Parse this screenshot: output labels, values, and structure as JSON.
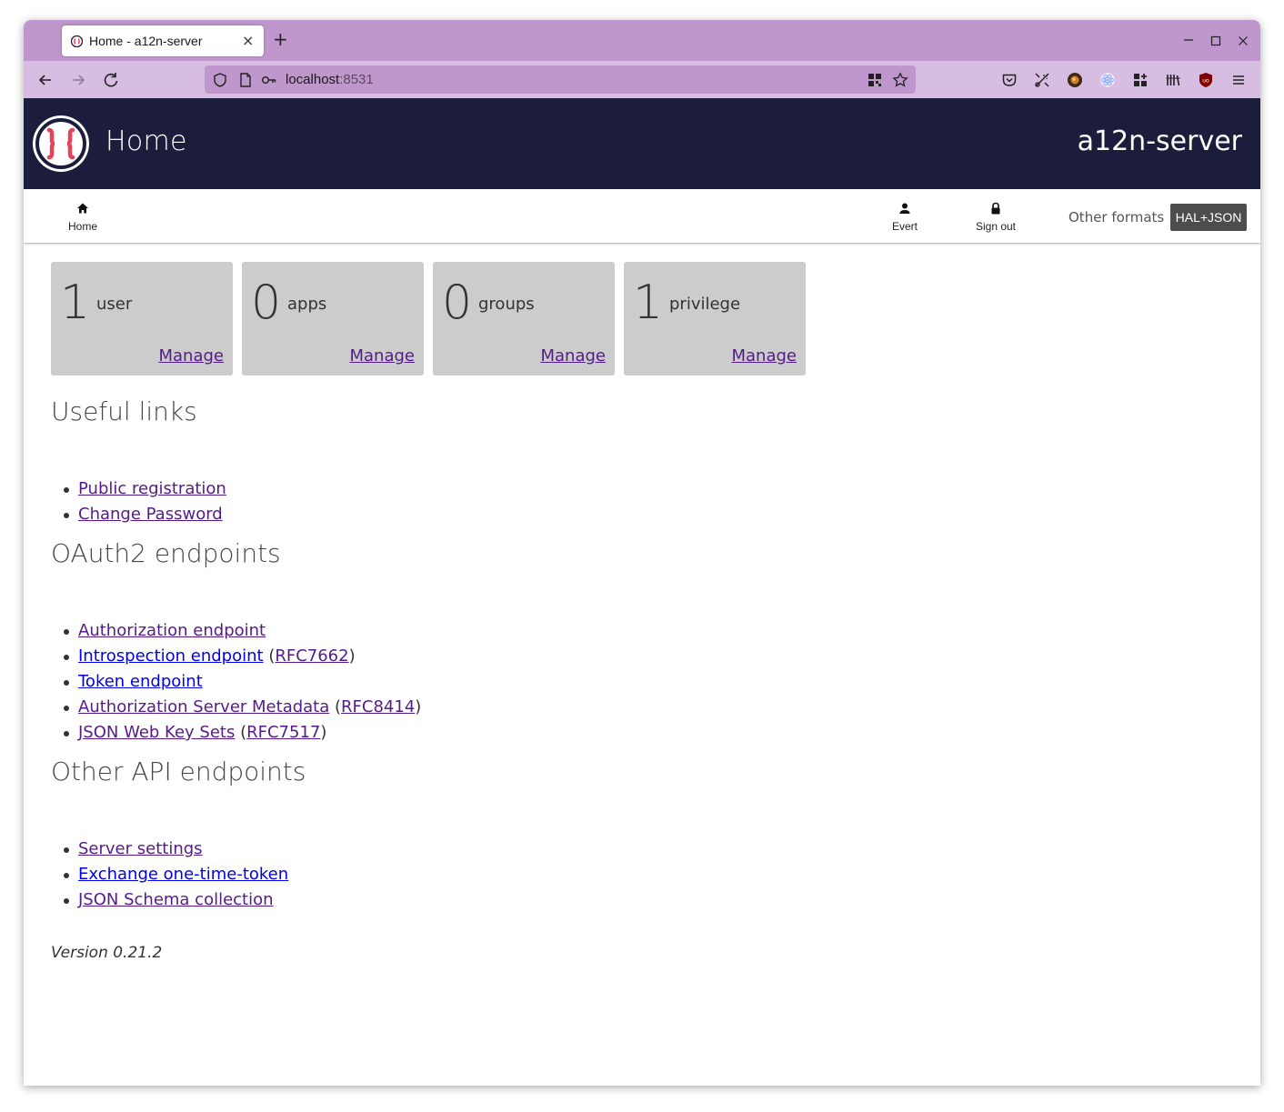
{
  "browser": {
    "tab_title": "Home - a12n-server",
    "new_tab": "+",
    "tab_close": "×",
    "url_host": "localhost",
    "url_port": ":8531"
  },
  "header": {
    "title": "Home",
    "app_name": "a12n-server"
  },
  "subnav": {
    "home_label": "Home",
    "user_label": "Evert",
    "signout_label": "Sign out",
    "other_formats": "Other formats",
    "format_button": "HAL+JSON"
  },
  "cards": [
    {
      "count": "1",
      "unit": "user",
      "action": "Manage"
    },
    {
      "count": "0",
      "unit": "apps",
      "action": "Manage"
    },
    {
      "count": "0",
      "unit": "groups",
      "action": "Manage"
    },
    {
      "count": "1",
      "unit": "privilege",
      "action": "Manage"
    }
  ],
  "useful_links": {
    "heading": "Useful links",
    "items": [
      "Public registration",
      "Change Password"
    ]
  },
  "oauth2": {
    "heading": "OAuth2 endpoints",
    "authorization": "Authorization endpoint",
    "introspection": "Introspection endpoint",
    "introspection_rfc": "RFC7662",
    "token": "Token endpoint",
    "metadata": "Authorization Server Metadata",
    "metadata_rfc": "RFC8414",
    "jwks": "JSON Web Key Sets",
    "jwks_rfc": "RFC7517"
  },
  "other_api": {
    "heading": "Other API endpoints",
    "items": [
      "Server settings",
      "Exchange one-time-token",
      "JSON Schema collection"
    ]
  },
  "version": "Version 0.21.2",
  "colors": {
    "tabstrip": "#bf97cc",
    "toolbar": "#d8bde2",
    "header_bg": "#1c1c3d",
    "card_bg": "#cccccc",
    "visited_link": "#551a8b",
    "link": "#0000ee"
  }
}
